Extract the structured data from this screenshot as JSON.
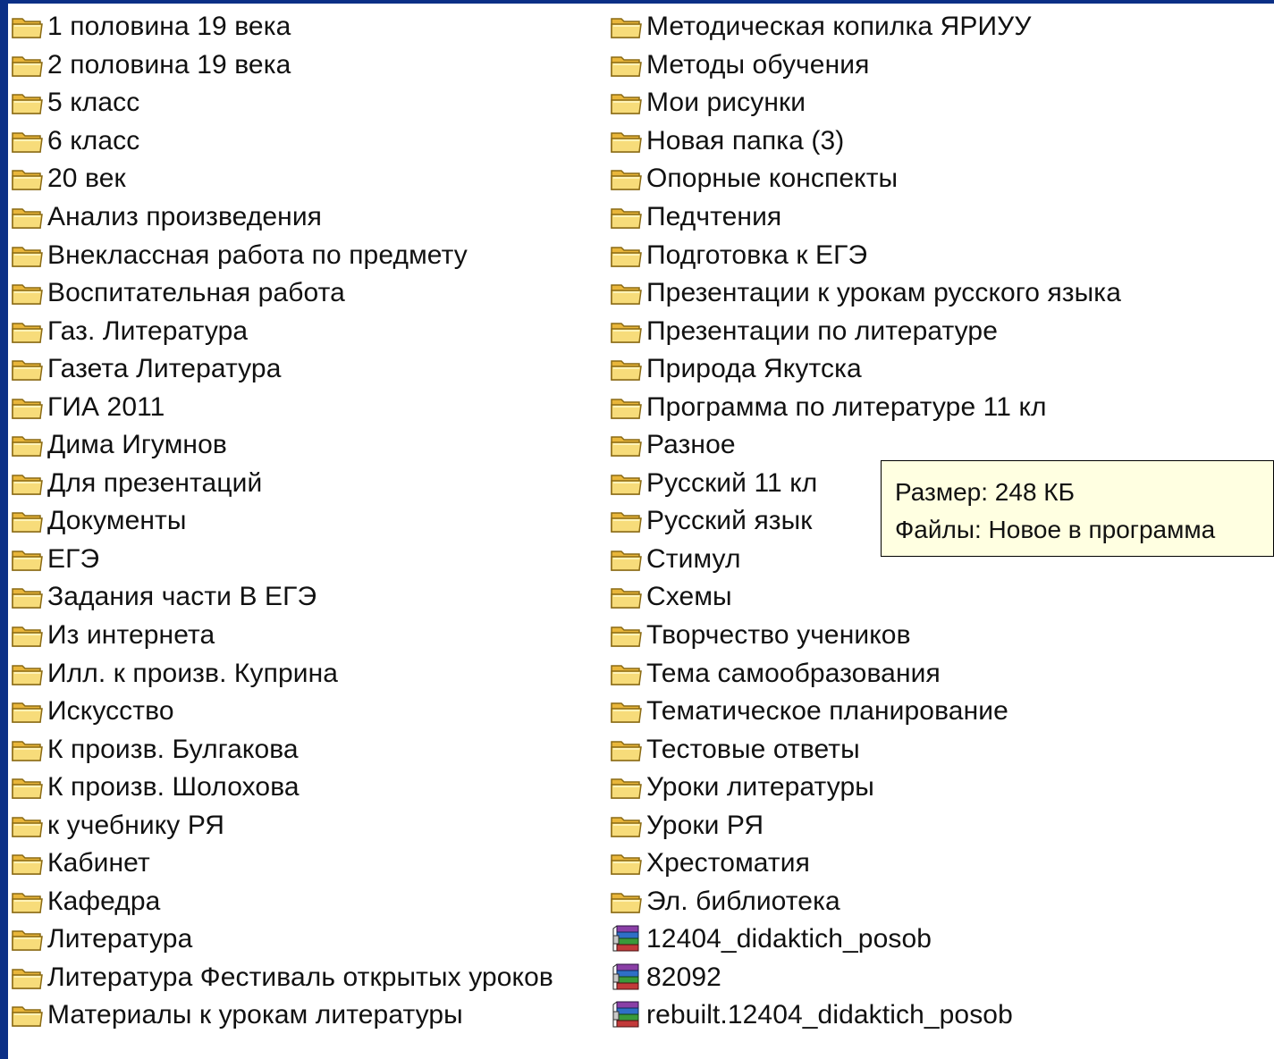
{
  "left_column": [
    {
      "label": "1 половина 19 века",
      "icon": "folder-icon"
    },
    {
      "label": "2 половина 19 века",
      "icon": "folder-icon"
    },
    {
      "label": "5 класс",
      "icon": "folder-icon"
    },
    {
      "label": "6 класс",
      "icon": "folder-icon"
    },
    {
      "label": "20 век",
      "icon": "folder-icon"
    },
    {
      "label": "Анализ произведения",
      "icon": "folder-icon"
    },
    {
      "label": "Внеклассная работа по предмету",
      "icon": "folder-icon"
    },
    {
      "label": "Воспитательная работа",
      "icon": "folder-icon"
    },
    {
      "label": "Газ. Литература",
      "icon": "folder-icon"
    },
    {
      "label": "Газета Литература",
      "icon": "folder-icon"
    },
    {
      "label": "ГИА 2011",
      "icon": "folder-icon"
    },
    {
      "label": "Дима Игумнов",
      "icon": "folder-icon"
    },
    {
      "label": "Для презентаций",
      "icon": "folder-icon"
    },
    {
      "label": "Документы",
      "icon": "folder-icon"
    },
    {
      "label": "ЕГЭ",
      "icon": "folder-icon"
    },
    {
      "label": "Задания части В ЕГЭ",
      "icon": "folder-icon"
    },
    {
      "label": "Из интернета",
      "icon": "folder-icon"
    },
    {
      "label": "Илл.  к произв. Куприна",
      "icon": "folder-icon"
    },
    {
      "label": "Искусство",
      "icon": "folder-icon"
    },
    {
      "label": "К произв. Булгакова",
      "icon": "folder-icon"
    },
    {
      "label": "К произв. Шолохова",
      "icon": "folder-icon"
    },
    {
      "label": "к учебнику РЯ",
      "icon": "folder-icon"
    },
    {
      "label": "Кабинет",
      "icon": "folder-icon"
    },
    {
      "label": "Кафедра",
      "icon": "folder-icon"
    },
    {
      "label": "Литература",
      "icon": "folder-icon"
    },
    {
      "label": "Литература Фестиваль открытых уроков",
      "icon": "folder-icon"
    },
    {
      "label": "Материалы к урокам литературы",
      "icon": "folder-icon"
    }
  ],
  "right_column": [
    {
      "label": "Методическая копилка ЯРИУУ",
      "icon": "folder-icon"
    },
    {
      "label": "Методы обучения",
      "icon": "folder-icon"
    },
    {
      "label": "Мои рисунки",
      "icon": "folder-icon"
    },
    {
      "label": "Новая папка (3)",
      "icon": "folder-icon"
    },
    {
      "label": "Опорные конспекты",
      "icon": "folder-icon"
    },
    {
      "label": "Педчтения",
      "icon": "folder-icon"
    },
    {
      "label": "Подготовка к ЕГЭ",
      "icon": "folder-icon"
    },
    {
      "label": "Презентации к урокам русского языка",
      "icon": "folder-icon"
    },
    {
      "label": "Презентации по литературе",
      "icon": "folder-icon"
    },
    {
      "label": "Природа Якутска",
      "icon": "folder-icon"
    },
    {
      "label": "Программа по литературе 11 кл",
      "icon": "folder-icon"
    },
    {
      "label": "Разное",
      "icon": "folder-icon"
    },
    {
      "label": "Русский 11 кл",
      "icon": "folder-icon"
    },
    {
      "label": "Русский язык",
      "icon": "folder-icon"
    },
    {
      "label": "Стимул",
      "icon": "folder-icon"
    },
    {
      "label": "Схемы",
      "icon": "folder-icon"
    },
    {
      "label": "Творчество учеников",
      "icon": "folder-icon"
    },
    {
      "label": "Тема самообразования",
      "icon": "folder-icon"
    },
    {
      "label": "Тематическое планирование",
      "icon": "folder-icon"
    },
    {
      "label": "Тестовые ответы",
      "icon": "folder-icon"
    },
    {
      "label": "Уроки литературы",
      "icon": "folder-icon"
    },
    {
      "label": "Уроки РЯ",
      "icon": "folder-icon"
    },
    {
      "label": "Хрестоматия",
      "icon": "folder-icon"
    },
    {
      "label": "Эл. библиотека",
      "icon": "folder-icon"
    },
    {
      "label": "12404_didaktich_posob",
      "icon": "archive-icon"
    },
    {
      "label": "82092",
      "icon": "archive-icon"
    },
    {
      "label": "rebuilt.12404_didaktich_posob",
      "icon": "archive-icon"
    }
  ],
  "tooltip": {
    "size_line": "Размер: 248 КБ",
    "files_line": "Файлы: Новое в программа"
  },
  "colors": {
    "background": "#0b2f86",
    "folder_fill": "#f5d56a",
    "tooltip_bg": "#ffffe1"
  }
}
